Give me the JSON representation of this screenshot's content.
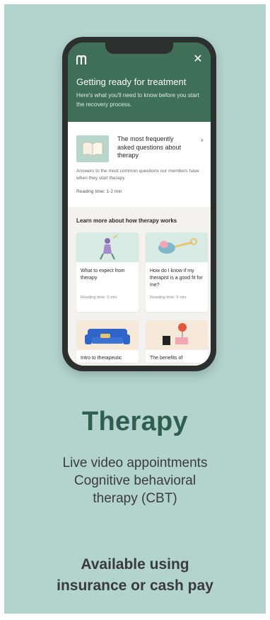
{
  "header": {
    "title": "Getting ready for treatment",
    "subtitle": "Here's what you'll need to know before you start the recovery process."
  },
  "faq": {
    "title": "The most frequently asked questions about therapy",
    "description": "Answers to the most common questions our members have when they start therapy",
    "reading_time": "Reading time: 1-2 min"
  },
  "learn": {
    "heading": "Learn more about how therapy works",
    "cards": [
      {
        "title": "What to expect from therapy",
        "reading_time": "Reading time: 5 min"
      },
      {
        "title": "How do I know if my therapist is a good fit for me?",
        "reading_time": "Reading time: 5 min"
      },
      {
        "title": "Intro to therapeutic"
      },
      {
        "title": "The benefits of"
      }
    ]
  },
  "product": {
    "title": "Therapy",
    "features": [
      "Live video appointments",
      "Cognitive behavioral",
      "therapy (CBT)"
    ],
    "availability_line1": "Available using",
    "availability_line2": "insurance or cash pay"
  },
  "colors": {
    "background": "#b2d4cc",
    "brand_green": "#3f6e59",
    "title_green": "#2f5e4d"
  },
  "icons": [
    "logo-icon",
    "close-icon",
    "chevron-right-icon"
  ]
}
